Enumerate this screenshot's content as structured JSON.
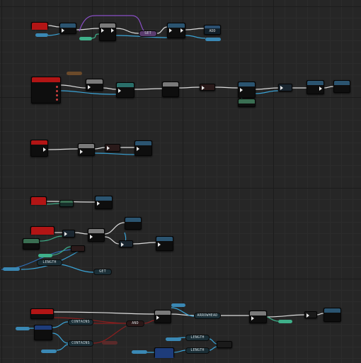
{
  "graph": {
    "row1": {
      "set_label": "SET",
      "add_label": "ADD"
    },
    "row5": {
      "length_label": "LENGTH",
      "get_label": "GET"
    },
    "row6": {
      "contains_label_1": "CONTAINS",
      "contains_label_2": "CONTAINS",
      "and_label": "AND",
      "arrow_label": "ARROWHEAD",
      "length_label_1": "LENGTH",
      "length_label_2": "LENGTH"
    }
  },
  "colors": {
    "event_header": "#b21515",
    "func_header": "#2b5470",
    "pure_header": "#3a6e52",
    "macro_header": "#7a7a7a",
    "exec_wire": "#e8e8e8",
    "object_wire": "#3aa3d6",
    "bool_wire": "#8c1e1e",
    "int_wire": "#3fb08a",
    "struct_wire": "#2e6fb7",
    "delegate_wire": "#9b4bd1"
  }
}
